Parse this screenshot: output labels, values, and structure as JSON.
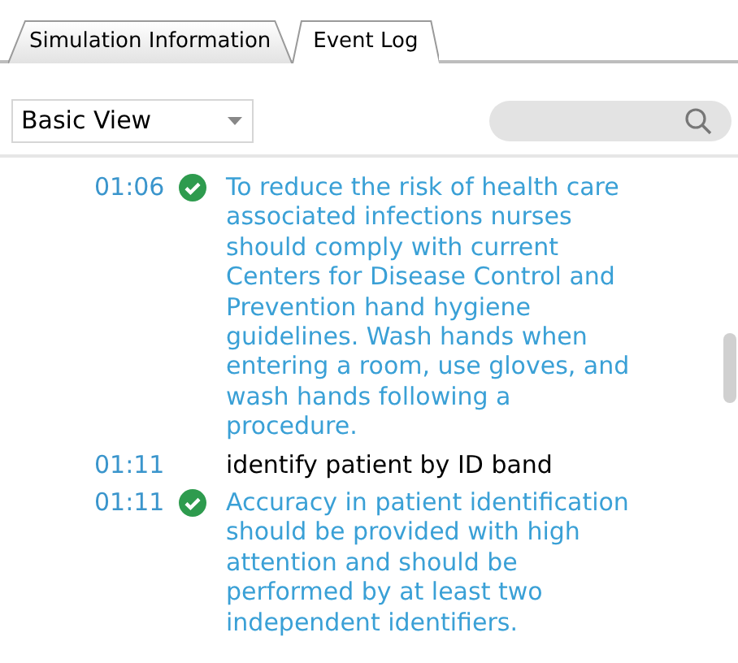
{
  "tabs": [
    {
      "label": "Simulation Information",
      "selected": false
    },
    {
      "label": "Event Log",
      "selected": true
    }
  ],
  "view_select": {
    "value": "Basic View"
  },
  "events": [
    {
      "time": "01:06",
      "kind": "feedback",
      "text": "To reduce the risk of health care associated infections nurses should comply with current Centers for Disease Control and Prevention hand hygiene guidelines. Wash hands when entering a room, use gloves, and wash hands following a procedure."
    },
    {
      "time": "01:11",
      "kind": "action",
      "text": "identify patient by ID band"
    },
    {
      "time": "01:11",
      "kind": "feedback",
      "text": "Accuracy in patient identification should be provided with high attention and should be performed by at least two independent identifiers."
    }
  ]
}
